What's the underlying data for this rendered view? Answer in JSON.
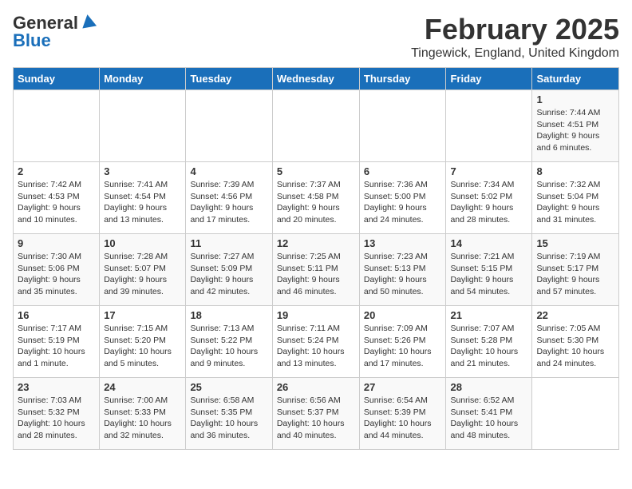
{
  "header": {
    "logo_general": "General",
    "logo_blue": "Blue",
    "title": "February 2025",
    "subtitle": "Tingewick, England, United Kingdom"
  },
  "days_of_week": [
    "Sunday",
    "Monday",
    "Tuesday",
    "Wednesday",
    "Thursday",
    "Friday",
    "Saturday"
  ],
  "weeks": [
    [
      {
        "day": "",
        "info": ""
      },
      {
        "day": "",
        "info": ""
      },
      {
        "day": "",
        "info": ""
      },
      {
        "day": "",
        "info": ""
      },
      {
        "day": "",
        "info": ""
      },
      {
        "day": "",
        "info": ""
      },
      {
        "day": "1",
        "info": "Sunrise: 7:44 AM\nSunset: 4:51 PM\nDaylight: 9 hours and 6 minutes."
      }
    ],
    [
      {
        "day": "2",
        "info": "Sunrise: 7:42 AM\nSunset: 4:53 PM\nDaylight: 9 hours and 10 minutes."
      },
      {
        "day": "3",
        "info": "Sunrise: 7:41 AM\nSunset: 4:54 PM\nDaylight: 9 hours and 13 minutes."
      },
      {
        "day": "4",
        "info": "Sunrise: 7:39 AM\nSunset: 4:56 PM\nDaylight: 9 hours and 17 minutes."
      },
      {
        "day": "5",
        "info": "Sunrise: 7:37 AM\nSunset: 4:58 PM\nDaylight: 9 hours and 20 minutes."
      },
      {
        "day": "6",
        "info": "Sunrise: 7:36 AM\nSunset: 5:00 PM\nDaylight: 9 hours and 24 minutes."
      },
      {
        "day": "7",
        "info": "Sunrise: 7:34 AM\nSunset: 5:02 PM\nDaylight: 9 hours and 28 minutes."
      },
      {
        "day": "8",
        "info": "Sunrise: 7:32 AM\nSunset: 5:04 PM\nDaylight: 9 hours and 31 minutes."
      }
    ],
    [
      {
        "day": "9",
        "info": "Sunrise: 7:30 AM\nSunset: 5:06 PM\nDaylight: 9 hours and 35 minutes."
      },
      {
        "day": "10",
        "info": "Sunrise: 7:28 AM\nSunset: 5:07 PM\nDaylight: 9 hours and 39 minutes."
      },
      {
        "day": "11",
        "info": "Sunrise: 7:27 AM\nSunset: 5:09 PM\nDaylight: 9 hours and 42 minutes."
      },
      {
        "day": "12",
        "info": "Sunrise: 7:25 AM\nSunset: 5:11 PM\nDaylight: 9 hours and 46 minutes."
      },
      {
        "day": "13",
        "info": "Sunrise: 7:23 AM\nSunset: 5:13 PM\nDaylight: 9 hours and 50 minutes."
      },
      {
        "day": "14",
        "info": "Sunrise: 7:21 AM\nSunset: 5:15 PM\nDaylight: 9 hours and 54 minutes."
      },
      {
        "day": "15",
        "info": "Sunrise: 7:19 AM\nSunset: 5:17 PM\nDaylight: 9 hours and 57 minutes."
      }
    ],
    [
      {
        "day": "16",
        "info": "Sunrise: 7:17 AM\nSunset: 5:19 PM\nDaylight: 10 hours and 1 minute."
      },
      {
        "day": "17",
        "info": "Sunrise: 7:15 AM\nSunset: 5:20 PM\nDaylight: 10 hours and 5 minutes."
      },
      {
        "day": "18",
        "info": "Sunrise: 7:13 AM\nSunset: 5:22 PM\nDaylight: 10 hours and 9 minutes."
      },
      {
        "day": "19",
        "info": "Sunrise: 7:11 AM\nSunset: 5:24 PM\nDaylight: 10 hours and 13 minutes."
      },
      {
        "day": "20",
        "info": "Sunrise: 7:09 AM\nSunset: 5:26 PM\nDaylight: 10 hours and 17 minutes."
      },
      {
        "day": "21",
        "info": "Sunrise: 7:07 AM\nSunset: 5:28 PM\nDaylight: 10 hours and 21 minutes."
      },
      {
        "day": "22",
        "info": "Sunrise: 7:05 AM\nSunset: 5:30 PM\nDaylight: 10 hours and 24 minutes."
      }
    ],
    [
      {
        "day": "23",
        "info": "Sunrise: 7:03 AM\nSunset: 5:32 PM\nDaylight: 10 hours and 28 minutes."
      },
      {
        "day": "24",
        "info": "Sunrise: 7:00 AM\nSunset: 5:33 PM\nDaylight: 10 hours and 32 minutes."
      },
      {
        "day": "25",
        "info": "Sunrise: 6:58 AM\nSunset: 5:35 PM\nDaylight: 10 hours and 36 minutes."
      },
      {
        "day": "26",
        "info": "Sunrise: 6:56 AM\nSunset: 5:37 PM\nDaylight: 10 hours and 40 minutes."
      },
      {
        "day": "27",
        "info": "Sunrise: 6:54 AM\nSunset: 5:39 PM\nDaylight: 10 hours and 44 minutes."
      },
      {
        "day": "28",
        "info": "Sunrise: 6:52 AM\nSunset: 5:41 PM\nDaylight: 10 hours and 48 minutes."
      },
      {
        "day": "",
        "info": ""
      }
    ]
  ]
}
